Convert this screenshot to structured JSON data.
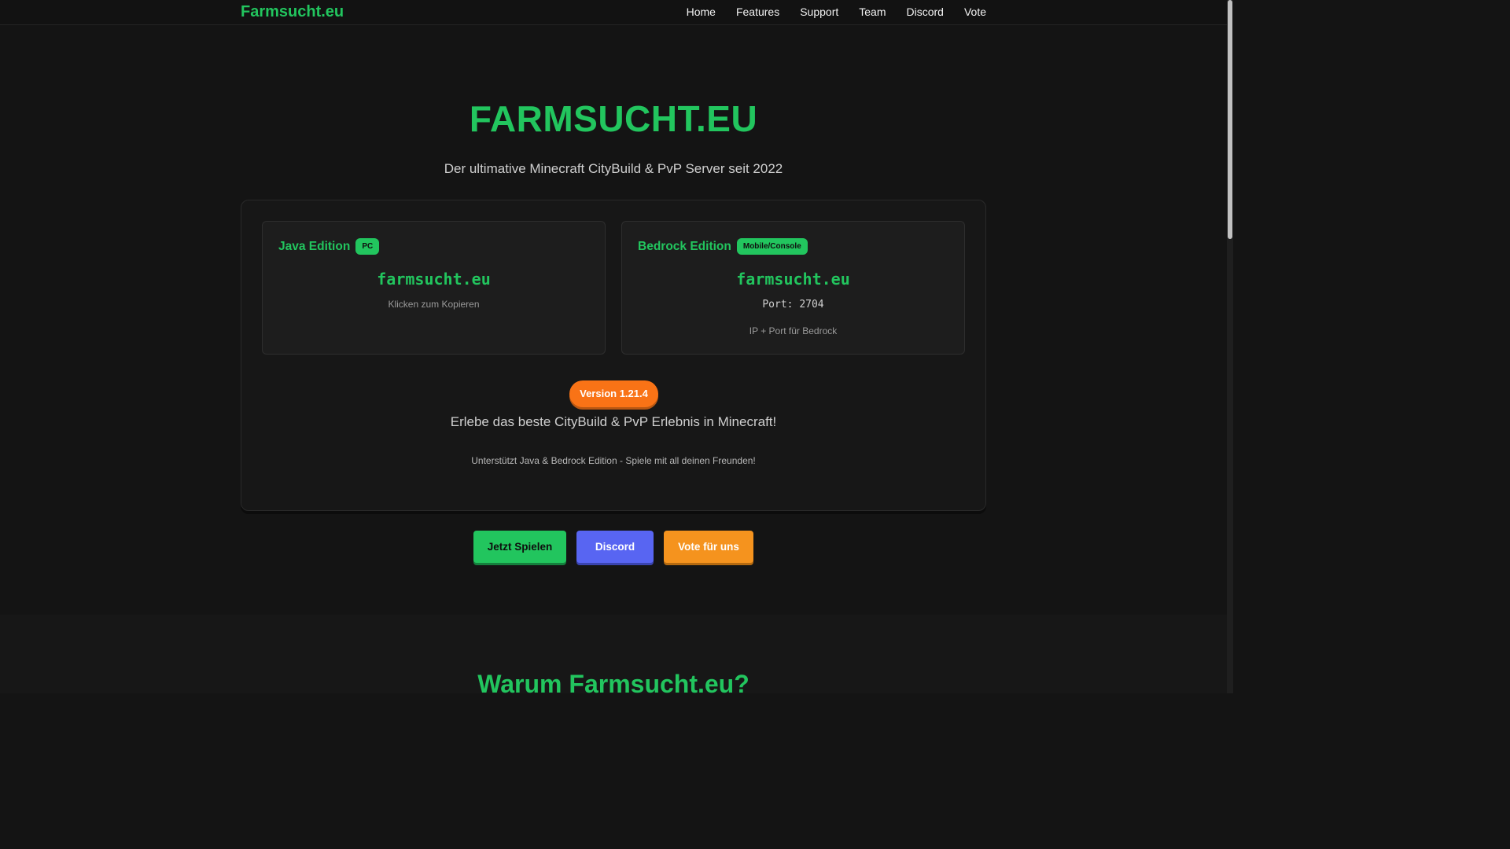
{
  "nav": {
    "brand": "Farmsucht.eu",
    "links": [
      "Home",
      "Features",
      "Support",
      "Team",
      "Discord",
      "Vote"
    ]
  },
  "hero": {
    "title": "FARMSUCHT.EU",
    "subtitle": "Der ultimative Minecraft CityBuild & PvP Server seit 2022"
  },
  "java": {
    "title": "Java Edition",
    "badge": "PC",
    "ip": "farmsucht.eu",
    "hint": "Klicken zum Kopieren"
  },
  "bedrock": {
    "title": "Bedrock Edition",
    "badge": "Mobile/Console",
    "ip": "farmsucht.eu",
    "port": "Port: 2704",
    "hint": "IP + Port für Bedrock"
  },
  "panel": {
    "version": "Version 1.21.4",
    "tagline": "Erlebe das beste CityBuild & PvP Erlebnis in Minecraft!",
    "note": "Unterstützt Java & Bedrock Edition - Spiele mit all deinen Freunden!"
  },
  "cta": {
    "play": "Jetzt Spielen",
    "discord": "Discord",
    "vote": "Vote für uns"
  },
  "features": {
    "title": "Warum Farmsucht.eu?"
  },
  "colors": {
    "accent": "#22c55e",
    "discord": "#5865f2",
    "orange": "#f97316",
    "background": "#141414"
  }
}
